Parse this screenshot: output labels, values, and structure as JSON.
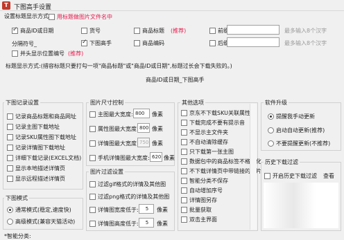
{
  "window": {
    "title": "下图高手设置",
    "icon_text": "T"
  },
  "title_settings": {
    "group_title": "设置标题显示方式",
    "top_option": {
      "label": "用标题做图片文件名中",
      "checked": false
    },
    "row1": [
      {
        "label": "商品ID或日期",
        "checked": true
      },
      {
        "label": "货号",
        "checked": false
      },
      {
        "label": "商品标题",
        "checked": false,
        "note": "(推荐)"
      },
      {
        "label": "前缀",
        "checked": false,
        "hint": "最多输入8个汉字"
      }
    ],
    "separator_label": "分隔符号_",
    "row2": [
      {
        "label": "下图高手",
        "checked": true
      },
      {
        "label": "商品编码",
        "checked": false
      },
      {
        "label": "后缀",
        "checked": false,
        "hint": "最多输入8个汉字"
      }
    ],
    "position_option": {
      "label": "并头显示位置编号",
      "checked": false,
      "note": "(推荐)"
    },
    "desc": "标题显示方式:(措容标题只要打勾一项\"商品标题\"或\"商品ID或日期\",标题过长会下载失败的。)",
    "preview": "商品ID或日期_下图高手"
  },
  "download_record": {
    "group_title": "下图记录设置",
    "items": [
      {
        "label": "记录商品标题和商品网址",
        "checked": false
      },
      {
        "label": "记录主图下载地址",
        "checked": false
      },
      {
        "label": "记录SKU属性图下载地址",
        "checked": false
      },
      {
        "label": "记录详情图下载地址",
        "checked": false
      },
      {
        "label": "详细下载记录(EXCEL文档)",
        "checked": false
      },
      {
        "label": "显示本地描述详情页",
        "checked": false
      },
      {
        "label": "显示远程描述详情页",
        "checked": false
      }
    ]
  },
  "download_mode": {
    "group_title": "下图模式",
    "items": [
      {
        "label": "通常模式(稳定,速度快)",
        "selected": true
      },
      {
        "label": "高级模式(兼容天猫活动)",
        "selected": false
      }
    ]
  },
  "image_size": {
    "group_title": "图片尺寸控制",
    "items": [
      {
        "label": "主图最大宽度:",
        "value": "800",
        "unit": "像素",
        "checked": false,
        "disabled": false
      },
      {
        "label": "属性图最大宽度:",
        "value": "800",
        "unit": "像素",
        "checked": false,
        "disabled": false
      },
      {
        "label": "详情图最大宽度:",
        "value": "750",
        "unit": "像素",
        "checked": false,
        "disabled": true
      },
      {
        "label": "手机详情图最大宽度:",
        "value": "620",
        "unit": "像素",
        "checked": false,
        "disabled": false
      }
    ]
  },
  "image_filter": {
    "group_title": "图片过滤设置",
    "items": [
      {
        "label": "过滤gif格式的详情及其他图",
        "checked": false
      },
      {
        "label": "过滤png格式的详情及其他图",
        "checked": false
      },
      {
        "label": "详情图宽度低于:",
        "value": "5",
        "unit": "像素",
        "checked": false
      },
      {
        "label": "详情图高度低于:",
        "value": "5",
        "unit": "像素",
        "checked": false
      }
    ]
  },
  "other_options": {
    "group_title": "其他选项",
    "items": [
      {
        "label": "京东不下载SKU关联属性图",
        "checked": false
      },
      {
        "label": "下载完成不要有提示音",
        "checked": false
      },
      {
        "label": "不显示主文件夹",
        "checked": false
      },
      {
        "label": "不自动清除缓存",
        "checked": false
      },
      {
        "label": "只下载第一张主图",
        "checked": false
      },
      {
        "label": "数据包中的商品标签不格式化",
        "checked": false
      },
      {
        "label": "不下载详情页中带链接的图片",
        "checked": false
      },
      {
        "label": "智能分类不保存",
        "checked": false
      },
      {
        "label": "自动增加序号",
        "checked": false
      },
      {
        "label": "详情图另存",
        "checked": false
      },
      {
        "label": "批量获取",
        "checked": false
      },
      {
        "label": "双击主界面",
        "checked": false
      }
    ]
  },
  "software_upgrade": {
    "group_title": "软件升级",
    "items": [
      {
        "label": "提醒我手动更新",
        "selected": true
      },
      {
        "label": "启动自动更新(推荐)",
        "selected": false
      },
      {
        "label": "不要提醒更新(不推荐)",
        "selected": false
      }
    ]
  },
  "history": {
    "group_title": "历史下载过滤",
    "option": {
      "label": "开启历史下载过滤",
      "checked": false
    },
    "view_label": "查看"
  },
  "footer": {
    "text": "*智能分类:"
  },
  "colors": {
    "accent_red": "#e8194c",
    "window_bg": "#f0f0f0"
  }
}
